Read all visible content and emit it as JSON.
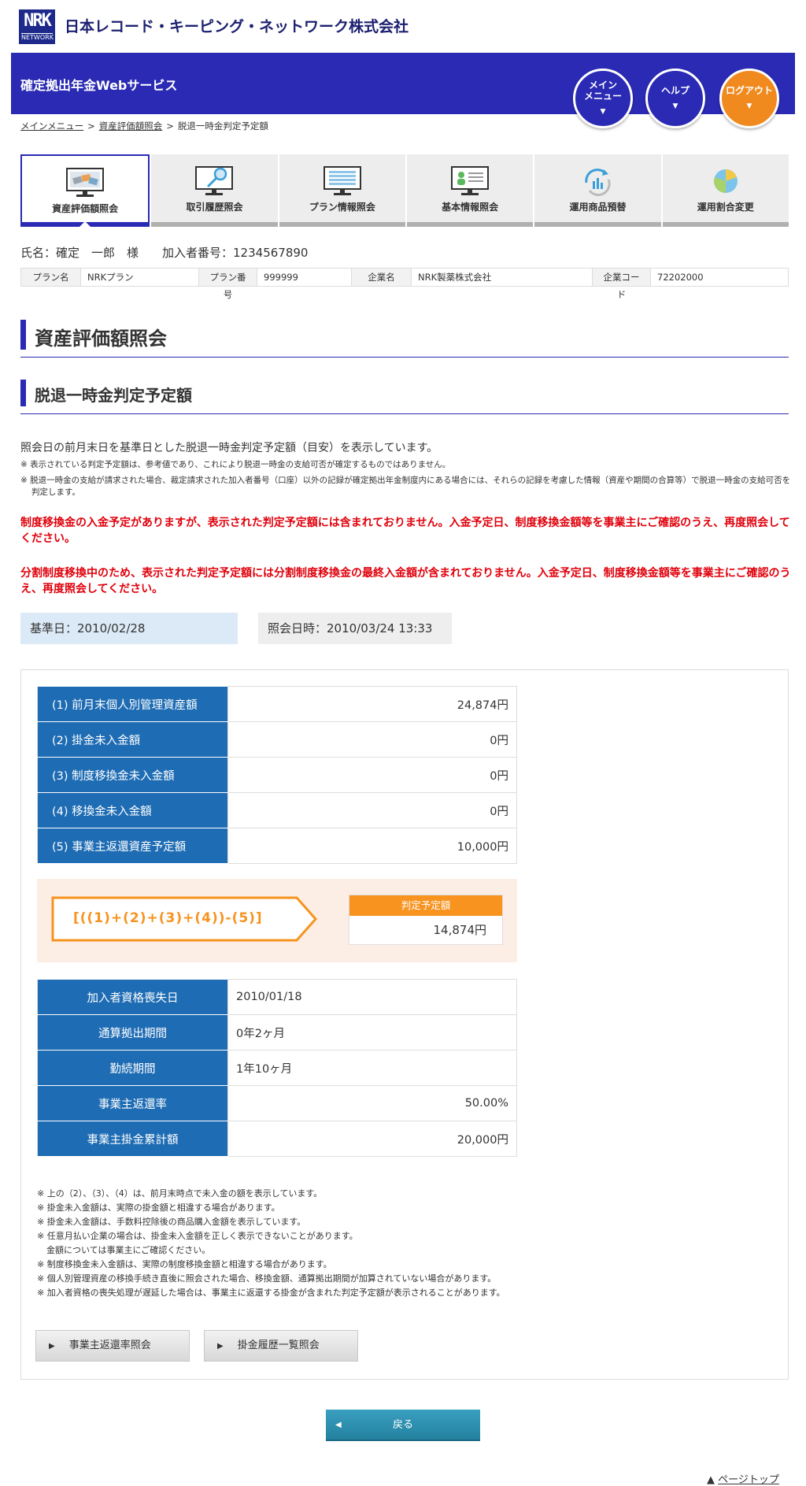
{
  "header": {
    "logo_top": "NRK",
    "logo_bottom": "NETWORK",
    "company": "日本レコード・キーピング・ネットワーク株式会社",
    "service_title": "確定拠出年金Webサービス",
    "main_menu": "メイン\nメニュー",
    "main_menu_1": "メイン",
    "main_menu_2": "メニュー",
    "help": "ヘルプ",
    "logout": "ログアウト"
  },
  "breadcrumb": {
    "items": [
      "メインメニュー",
      "資産評価額照会",
      "脱退一時金判定予定額"
    ]
  },
  "nav": {
    "tabs": [
      {
        "label": "資産評価額照会",
        "icon": "monitor-money-icon"
      },
      {
        "label": "取引履歴照会",
        "icon": "monitor-search-icon"
      },
      {
        "label": "プラン情報照会",
        "icon": "monitor-list-icon"
      },
      {
        "label": "基本情報照会",
        "icon": "monitor-person-icon"
      },
      {
        "label": "運用商品預替",
        "icon": "refresh-chart-icon"
      },
      {
        "label": "運用割合変更",
        "icon": "pie-chart-icon"
      }
    ]
  },
  "user": {
    "name": "氏名：確定　一郎　様",
    "member_no": "加入者番号：1234567890",
    "plan_label": "プラン名",
    "plan_value": "NRKプラン",
    "plan_no_label": "プラン番号",
    "plan_no_value": "999999",
    "company_label": "企業名",
    "company_value": "NRK製薬株式会社",
    "code_label": "企業コード",
    "code_value": "72202000"
  },
  "page": {
    "title": "資産評価額照会",
    "subtitle": "脱退一時金判定予定額",
    "intro": "照会日の前月末日を基準日とした脱退一時金判定予定額（目安）を表示しています。",
    "note1": "※ 表示されている判定予定額は、参考値であり、これにより脱退一時金の支給可否が確定するものではありません。",
    "note2": "※ 脱退一時金の支給が請求された場合、裁定請求された加入者番号（口座）以外の記録が確定拠出年金制度内にある場合には、それらの記録を考慮した情報（資産や期間の合算等）で脱退一時金の支給可否を判定します。",
    "red1": "制度移換金の入金予定がありますが、表示された判定予定額には含まれておりません。入金予定日、制度移換金額等を事業主にご確認のうえ、再度照会してください。",
    "red2": "分割制度移換中のため、表示された判定予定額には分割制度移換金の最終入金額が含まれておりません。入金予定日、制度移換金額等を事業主にご確認のうえ、再度照会してください。",
    "base_date": "基準日：2010/02/28",
    "inquiry_datetime": "照会日時：2010/03/24 13:33"
  },
  "amounts": [
    {
      "label": "(1)  前月末個人別管理資産額",
      "value": "24,874円"
    },
    {
      "label": "(2)          掛金未入金額",
      "value": "0円"
    },
    {
      "label": "(3)     制度移換金未入金額",
      "value": "0円"
    },
    {
      "label": "(4)        移換金未入金額",
      "value": "0円"
    },
    {
      "label": "(5)   事業主返還資産予定額",
      "value": "10,000円"
    }
  ],
  "formula": {
    "text": "[((1)+(2)+(3)+(4))-(5)]",
    "result_label": "判定予定額",
    "result_value": "14,874円"
  },
  "details": [
    {
      "label": "加入者資格喪失日",
      "value": "2010/01/18"
    },
    {
      "label": "通算拠出期間",
      "value": "0年2ヶ月"
    },
    {
      "label": "勤続期間",
      "value": "1年10ヶ月"
    },
    {
      "label": "事業主返還率",
      "value": "50.00%"
    },
    {
      "label": "事業主掛金累計額",
      "value": "20,000円"
    }
  ],
  "footnotes": [
    "※ 上の（2）、（3）、（4）は、前月末時点で未入金の額を表示しています。",
    "※ 掛金未入金額は、実際の掛金額と相違する場合があります。",
    "※ 掛金未入金額は、手数料控除後の商品購入金額を表示しています。",
    "※ 任意月払い企業の場合は、掛金未入金額を正しく表示できないことがあります。",
    "金額については事業主にご確認ください。",
    "※ 制度移換金未入金額は、実際の制度移換金額と相違する場合があります。",
    "※ 個人別管理資産の移換手続き直後に照会された場合、移換金額、通算拠出期間が加算されていない場合があります。",
    "※ 加入者資格の喪失処理が遅延した場合は、事業主に返還する掛金が含まれた判定予定額が表示されることがあります。"
  ],
  "buttons": {
    "refund_rate": "事業主返還率照会",
    "history": "掛金履歴一覧照会",
    "back": "戻る",
    "pagetop": "ページトップ"
  },
  "colors": {
    "brand_blue": "#2a2ab4",
    "table_blue": "#1e6cb4",
    "orange": "#f7931e",
    "alert_red": "#e0000b"
  }
}
